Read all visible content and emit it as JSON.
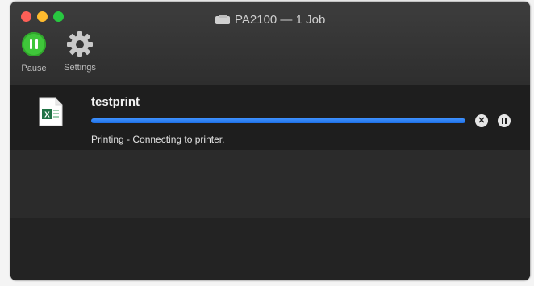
{
  "window": {
    "title": "PA2100 — 1 Job"
  },
  "toolbar": {
    "pause_label": "Pause",
    "settings_label": "Settings"
  },
  "job": {
    "name": "testprint",
    "status": "Printing - Connecting to printer.",
    "progress_percent": 100,
    "file_type_icon": "excel-file-icon"
  },
  "colors": {
    "pause_green": "#3fc63a",
    "progress_blue": "#2a7ef5",
    "excel_green": "#217346"
  }
}
